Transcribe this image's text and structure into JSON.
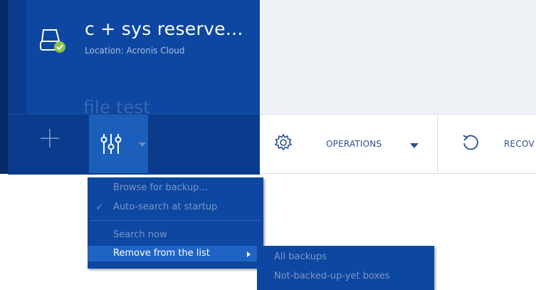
{
  "colors": {
    "sidebar_dark": "#0b3b8c",
    "sidebar_strip": "#062a66",
    "item_bg": "#0d47a1",
    "active_button": "#1b5fba",
    "menu_highlight": "#1f64c4",
    "status_ok": "#8bc34a",
    "toolbar_text": "#2d4f8a"
  },
  "backups": [
    {
      "title": "c + sys reserve...",
      "location": "Location: Acronis Cloud",
      "status_icon": "check-badge-icon"
    },
    {
      "title": "file test"
    }
  ],
  "sidebar_actions": {
    "add_icon": "plus-icon",
    "filter_icon": "sliders-icon"
  },
  "toolbar": {
    "operations_label": "OPERATIONS",
    "recover_label": "RECOV"
  },
  "context_menu": {
    "items": [
      {
        "label": "Browse for backup..."
      },
      {
        "label": "Auto-search at startup",
        "checked": true
      },
      {
        "label": "Search now"
      },
      {
        "label": "Remove from the list",
        "has_submenu": true,
        "selected": true
      }
    ],
    "submenu": {
      "items": [
        {
          "label": "All backups"
        },
        {
          "label": "Not-backed-up-yet boxes"
        }
      ]
    }
  }
}
